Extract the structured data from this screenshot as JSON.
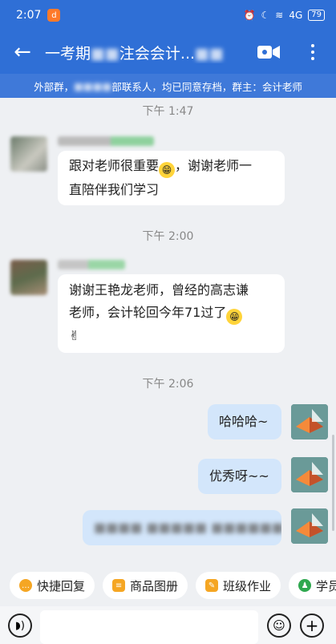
{
  "status_bar": {
    "time": "2:07",
    "notif_glyph": "d",
    "battery": "79",
    "signal": "4G"
  },
  "header": {
    "back_glyph": "←",
    "title_prefix": "一考期",
    "title_middle": "注会会计...",
    "title_blurred_a": "■■",
    "title_blurred_b": "■■"
  },
  "notice": {
    "text_prefix": "外部群，",
    "text_blurred": "■■■■",
    "text_suffix": "部联系人，均已同意存档，群主：会计老师"
  },
  "messages": [
    {
      "time": "下午 1:47",
      "side": "left",
      "text": "跟对老师很重要",
      "text2": "，谢谢老师一",
      "text3": "直陪伴我们学习"
    },
    {
      "time": "下午 2:00",
      "side": "left",
      "text": "谢谢王艳龙老师，曾经的高志谦",
      "text2": "老师，会计轮回今年71过了",
      "text3": "✌"
    },
    {
      "time": "下午 2:06",
      "side": "right",
      "text": "哈哈哈~"
    },
    {
      "side": "right",
      "text": "优秀呀~~"
    },
    {
      "side": "right",
      "text": "■■■■ ■■■■■ ■■■■■■"
    }
  ],
  "quick_actions": [
    {
      "label": "快捷回复",
      "icon": "chat-bubble-icon",
      "color": "#f5a623"
    },
    {
      "label": "商品图册",
      "icon": "catalog-icon",
      "color": "#f5a623"
    },
    {
      "label": "班级作业",
      "icon": "homework-icon",
      "color": "#f5a623"
    },
    {
      "label": "学员",
      "icon": "student-icon",
      "color": "#2fa84f"
    }
  ],
  "input": {
    "placeholder": ""
  }
}
